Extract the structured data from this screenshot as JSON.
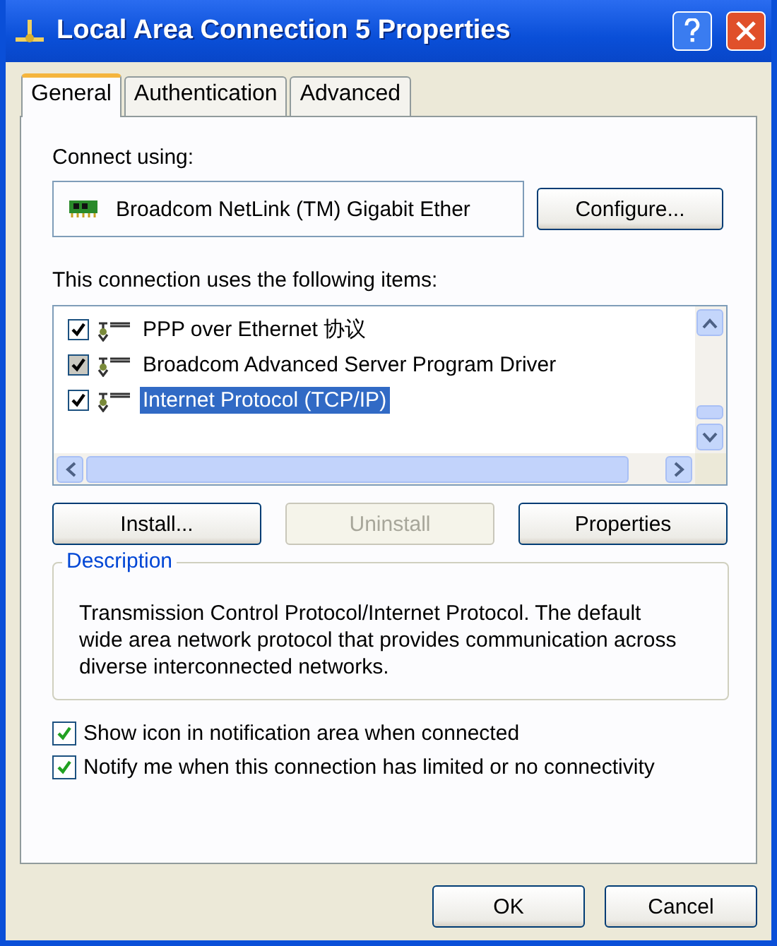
{
  "window": {
    "title": "Local Area Connection 5 Properties"
  },
  "tabs": [
    {
      "label": "General",
      "selected": true
    },
    {
      "label": "Authentication",
      "selected": false
    },
    {
      "label": "Advanced",
      "selected": false
    }
  ],
  "connect_using": {
    "label": "Connect using:",
    "adapter": "Broadcom NetLink (TM) Gigabit Ether",
    "button": "Configure..."
  },
  "items_label": "This connection uses the following items:",
  "items": [
    {
      "label": "PPP over Ethernet 协议",
      "checked": true,
      "disabled": false,
      "selected": false
    },
    {
      "label": "Broadcom Advanced Server Program Driver",
      "checked": true,
      "disabled": true,
      "selected": false
    },
    {
      "label": "Internet Protocol (TCP/IP)",
      "checked": true,
      "disabled": false,
      "selected": true
    }
  ],
  "item_buttons": [
    {
      "label": "Install...",
      "disabled": false
    },
    {
      "label": "Uninstall",
      "disabled": true
    },
    {
      "label": "Properties",
      "disabled": false
    }
  ],
  "description": {
    "title": "Description",
    "text": "Transmission Control Protocol/Internet Protocol. The default wide area network protocol that provides communication across diverse interconnected networks."
  },
  "options": [
    {
      "label": "Show icon in notification area when connected",
      "checked": true
    },
    {
      "label": "Notify me when this connection has limited or no connectivity",
      "checked": true
    }
  ],
  "buttons": [
    "OK",
    "Cancel"
  ]
}
